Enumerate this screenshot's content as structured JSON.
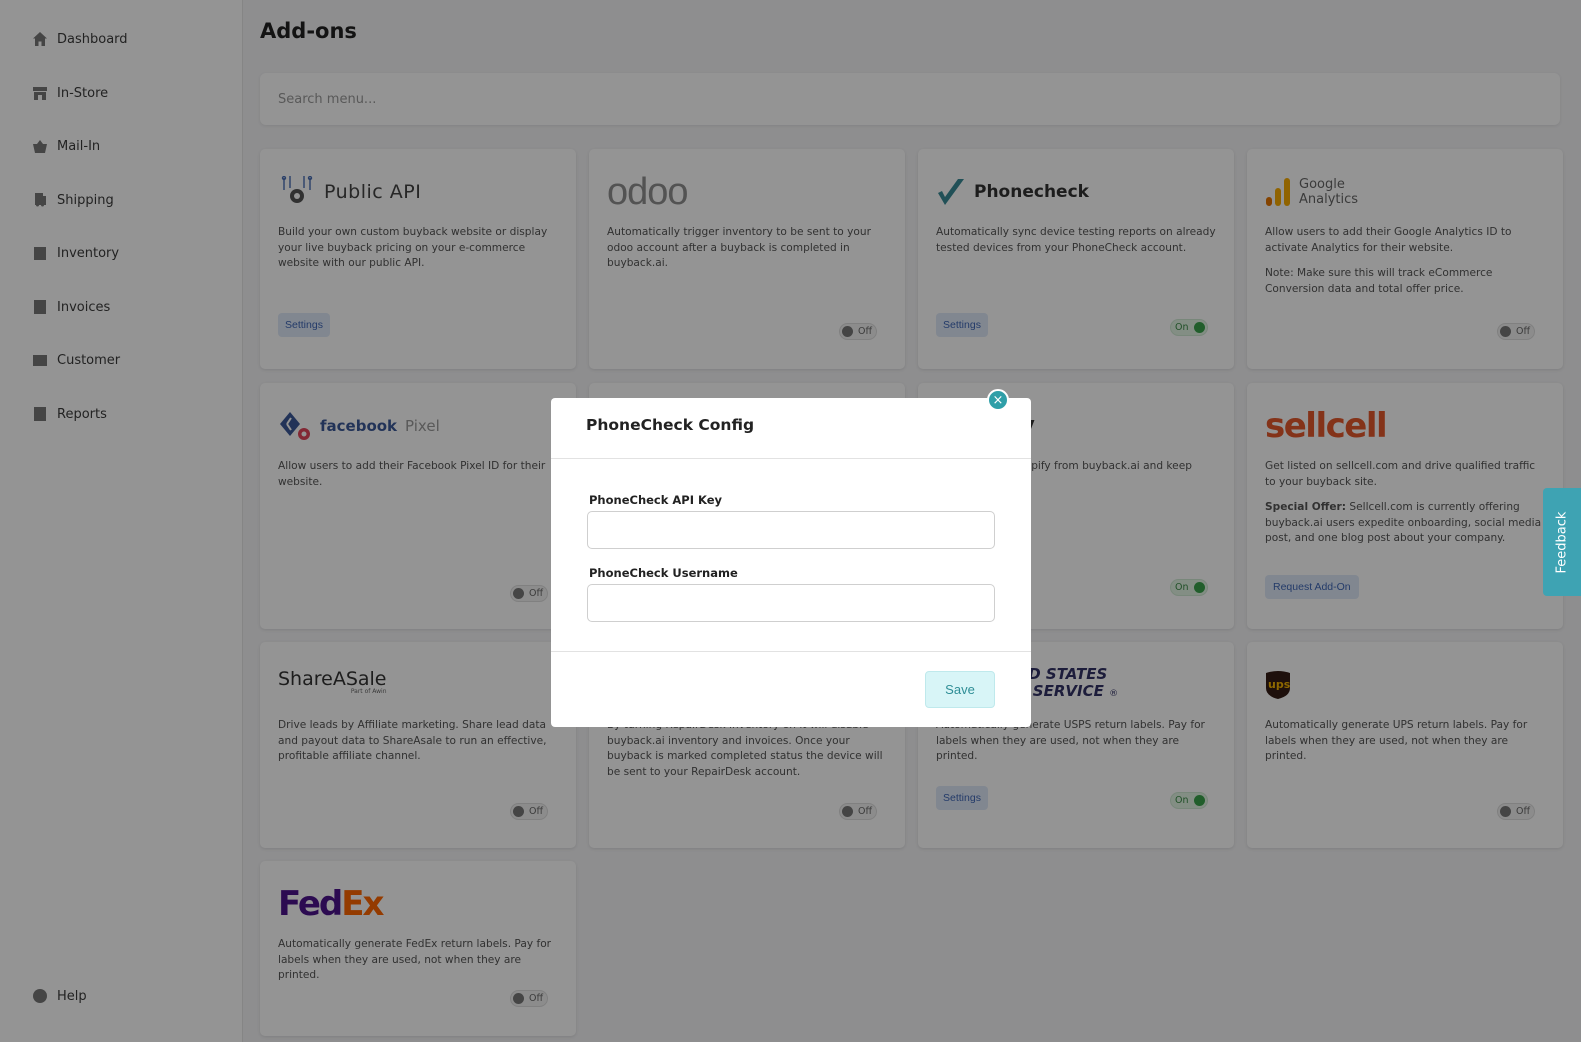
{
  "sidebar": {
    "items": [
      {
        "label": "Dashboard",
        "icon": "home-icon"
      },
      {
        "label": "In-Store",
        "icon": "store-icon"
      },
      {
        "label": "Mail-In",
        "icon": "basket-icon"
      },
      {
        "label": "Shipping",
        "icon": "truck-icon"
      },
      {
        "label": "Inventory",
        "icon": "box-icon"
      },
      {
        "label": "Invoices",
        "icon": "invoice-icon"
      },
      {
        "label": "Customer",
        "icon": "customer-icon"
      },
      {
        "label": "Reports",
        "icon": "report-icon"
      }
    ],
    "help": "Help"
  },
  "page": {
    "title": "Add-ons"
  },
  "search": {
    "placeholder": "Search menu..."
  },
  "cards": {
    "public_api": {
      "name": "Public API",
      "desc": "Build your own custom buyback website or display your live buyback pricing on your e-commerce website with our public API.",
      "settings": "Settings"
    },
    "odoo": {
      "name": "odoo",
      "desc": "Automatically trigger inventory to be sent to your odoo account after a buyback is completed in buyback.ai.",
      "toggle": "Off"
    },
    "phonecheck": {
      "name": "Phonecheck",
      "desc": "Automatically sync device testing reports on already tested devices from your PhoneCheck account.",
      "settings": "Settings",
      "toggle": "On"
    },
    "google": {
      "name_line1": "Google",
      "name_line2": "Analytics",
      "desc": "Allow users to add their Google Analytics ID to activate Analytics for their website.",
      "note": "Note: Make sure this will track eCommerce Conversion data and total offer price.",
      "toggle": "Off"
    },
    "facebook": {
      "name": "facebook",
      "sub": "Pixel",
      "desc": "Allow users to add their Facebook Pixel ID for their website.",
      "toggle": "Off"
    },
    "shopify": {
      "name": "y",
      "desc": "hopify from buyback.ai and keep",
      "toggle": "On"
    },
    "sellcell": {
      "name": "sellcell",
      "desc": "Get listed on sellcell.com and drive qualified traffic to your buyback site.",
      "offer_label": "Special Offer:",
      "offer_text": " Sellcell.com is currently offering buyback.ai users expedite onboarding, social media post, and one blog post about your company.",
      "button": "Request Add-On"
    },
    "shareasale": {
      "name": "ShareASale",
      "sub": "Part of Awin",
      "desc": "Drive leads by Affiliate marketing. Share lead data and payout data to ShareAsale to run an effective, profitable affiliate channel.",
      "toggle": "Off"
    },
    "repairdesk": {
      "desc": "By turning RepairDesk inventory on it will disable buyback.ai inventory and invoices. Once your buyback is marked completed status the device will be sent to your RepairDesk account.",
      "toggle": "Off"
    },
    "usps": {
      "name_line1": "ED STATES",
      "name_line2": "L SERVICE",
      "reg": "®",
      "desc": "Automatically generate USPS return labels. Pay for labels when they are used, not when they are printed.",
      "settings": "Settings",
      "toggle": "On"
    },
    "ups": {
      "name": "ups",
      "desc": "Automatically generate UPS return labels. Pay for labels when they are used, not when they are printed.",
      "toggle": "Off"
    },
    "fedex": {
      "name_fed": "Fed",
      "name_ex": "Ex",
      "desc": "Automatically generate FedEx return labels. Pay for labels when they are used, not when they are printed.",
      "toggle": "Off"
    }
  },
  "modal": {
    "title": "PhoneCheck Config",
    "close": "×",
    "api_key_label": "PhoneCheck API Key",
    "api_key_value": "",
    "username_label": "PhoneCheck Username",
    "username_value": "",
    "save": "Save"
  },
  "feedback": "Feedback",
  "colors": {
    "overlay": "#000000",
    "accent": "#2f9fa8",
    "toggle_on": "#3aa34a",
    "settings_bg": "#dfe8f8",
    "facebook": "#3b5998",
    "fedex_purple": "#4d148c",
    "fedex_orange": "#ff6600",
    "sellcell": "#e4582b",
    "usps": "#333366",
    "ups": "#351c15",
    "google_orange": "#f9ab00"
  }
}
